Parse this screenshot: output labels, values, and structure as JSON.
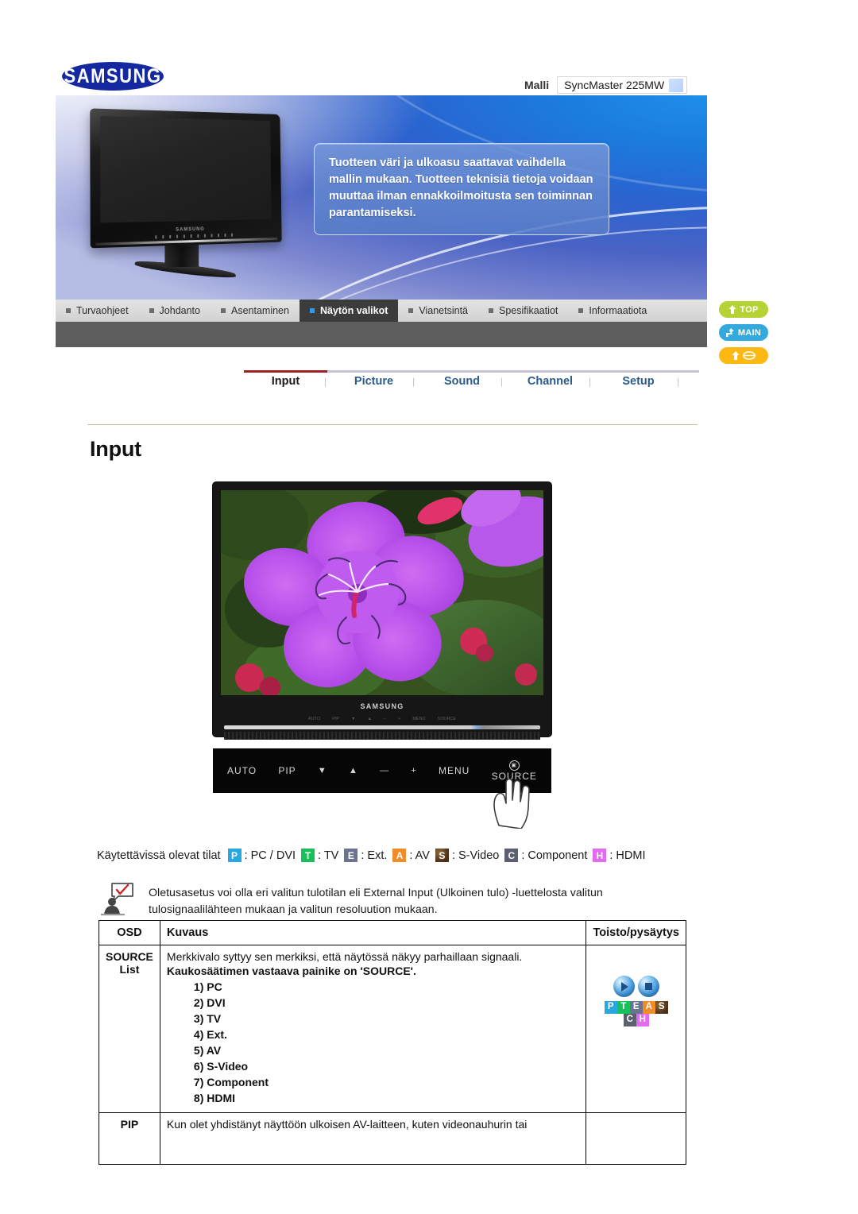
{
  "brand": {
    "logo_text": "SAMSUNG"
  },
  "header": {
    "model_label": "Malli",
    "model_value": "SyncMaster 225MW"
  },
  "banner": {
    "note": "Tuotteen väri ja ulkoasu saattavat vaihdella mallin mukaan. Tuotteen teknisiä tietoja voidaan muuttaa ilman ennakkoilmoitusta sen toiminnan parantamiseksi."
  },
  "nav": {
    "items": [
      {
        "label": "Turvaohjeet",
        "active": false
      },
      {
        "label": "Johdanto",
        "active": false
      },
      {
        "label": "Asentaminen",
        "active": false
      },
      {
        "label": "Näytön valikot",
        "active": true
      },
      {
        "label": "Vianetsintä",
        "active": false
      },
      {
        "label": "Spesifikaatiot",
        "active": false
      },
      {
        "label": "Informaatiota",
        "active": false
      }
    ]
  },
  "side_buttons": [
    {
      "label": "TOP",
      "icon": "arrow-up-icon",
      "color": "#b5d334"
    },
    {
      "label": "MAIN",
      "icon": "arrow-turn-icon",
      "color": "#33a9dc"
    },
    {
      "label": "",
      "icon": "arrow-up-book-icon",
      "color": "#fdb813"
    }
  ],
  "tabs": [
    {
      "label": "Input",
      "active": true
    },
    {
      "label": "Picture",
      "active": false
    },
    {
      "label": "Sound",
      "active": false
    },
    {
      "label": "Channel",
      "active": false
    },
    {
      "label": "Setup",
      "active": false
    }
  ],
  "page_title": "Input",
  "monitor": {
    "brand_text": "SAMSUNG",
    "osd_mini_icons": [
      "AUTO",
      "PIP",
      "▼",
      "▲",
      "−",
      "+",
      "MENU",
      "SOURCE"
    ],
    "controls": [
      "AUTO",
      "PIP",
      "▼",
      "▲",
      "—",
      "+",
      "MENU"
    ],
    "source_label": "SOURCE"
  },
  "modes": {
    "label": "Käytettävissä olevat tilat",
    "items": [
      {
        "letter": "P",
        "color": "#29a8df",
        "text": ": PC / DVI"
      },
      {
        "letter": "T",
        "color": "#18c05a",
        "text": ": TV"
      },
      {
        "letter": "E",
        "color": "#6b7390",
        "text": ": Ext."
      },
      {
        "letter": "A",
        "color": "#f08c2a",
        "text": ": AV"
      },
      {
        "letter": "S",
        "color": "#6d4a2a",
        "text": ": S-Video"
      },
      {
        "letter": "C",
        "color": "#5a6070",
        "text": ": Component"
      },
      {
        "letter": "H",
        "color": "#e26bf0",
        "text": ": HDMI"
      }
    ]
  },
  "note": {
    "text": "Oletusasetus voi olla eri valitun tulotilan eli External Input (Ulkoinen tulo) -luettelosta valitun tulosignaalilähteen mukaan ja valitun resoluution mukaan."
  },
  "table": {
    "headers": [
      "OSD",
      "Kuvaus",
      "Toisto/pysäytys"
    ],
    "rows": [
      {
        "osd_line1": "SOURCE",
        "osd_line2": "List",
        "desc_line": "Merkkivalo syttyy sen merkiksi, että näytössä näkyy parhaillaan signaali.",
        "desc_bold": "Kaukosäätimen vastaava painike on 'SOURCE'.",
        "list": [
          "1) PC",
          "2) DVI",
          "3) TV",
          "4) Ext.",
          "5) AV",
          "6) S-Video",
          "7) Component",
          "8) HDMI"
        ],
        "chips_row1": [
          {
            "letter": "P",
            "color": "#29a8df"
          },
          {
            "letter": "T",
            "color": "#18c05a"
          },
          {
            "letter": "E",
            "color": "#6b7390"
          },
          {
            "letter": "A",
            "color": "#f08c2a"
          },
          {
            "letter": "S",
            "color": "#6d4a2a"
          }
        ],
        "chips_row2": [
          {
            "letter": "C",
            "color": "#5a6070"
          },
          {
            "letter": "H",
            "color": "#e26bf0"
          }
        ]
      },
      {
        "osd_line1": "PIP",
        "osd_line2": "",
        "desc_line": "Kun olet yhdistänyt näyttöön ulkoisen AV-laitteen, kuten videonauhurin tai",
        "desc_bold": "",
        "list": [],
        "chips_row1": [],
        "chips_row2": []
      }
    ]
  }
}
